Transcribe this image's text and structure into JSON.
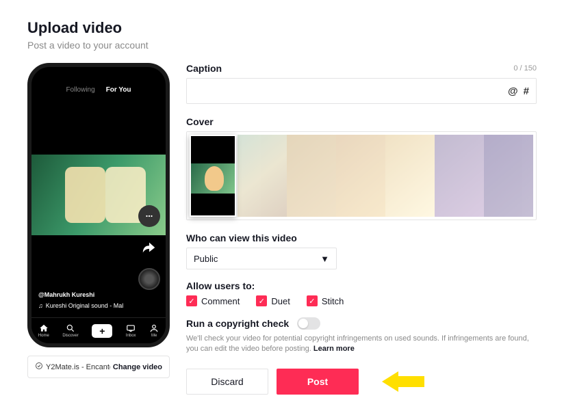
{
  "header": {
    "title": "Upload video",
    "subtitle": "Post a video to your account"
  },
  "phone": {
    "tab_following": "Following",
    "tab_foryou": "For You",
    "username": "@Mahrukh Kureshi",
    "sound": "Kureshi Original sound - Mal",
    "nav": {
      "home": "Home",
      "discover": "Discover",
      "inbox": "Inbox",
      "me": "Me"
    }
  },
  "file": {
    "name": "Y2Mate.is - Encanto bu...",
    "change": "Change video"
  },
  "caption": {
    "label": "Caption",
    "count": "0 / 150",
    "at": "@",
    "hash": "#"
  },
  "cover": {
    "label": "Cover"
  },
  "privacy": {
    "label": "Who can view this video",
    "selected": "Public"
  },
  "allow": {
    "label": "Allow users to:",
    "comment": "Comment",
    "duet": "Duet",
    "stitch": "Stitch"
  },
  "copyright": {
    "label": "Run a copyright check",
    "hint": "We'll check your video for potential copyright infringements on used sounds. If infringements are found, you can edit the video before posting.",
    "learn": "Learn more"
  },
  "buttons": {
    "discard": "Discard",
    "post": "Post"
  }
}
